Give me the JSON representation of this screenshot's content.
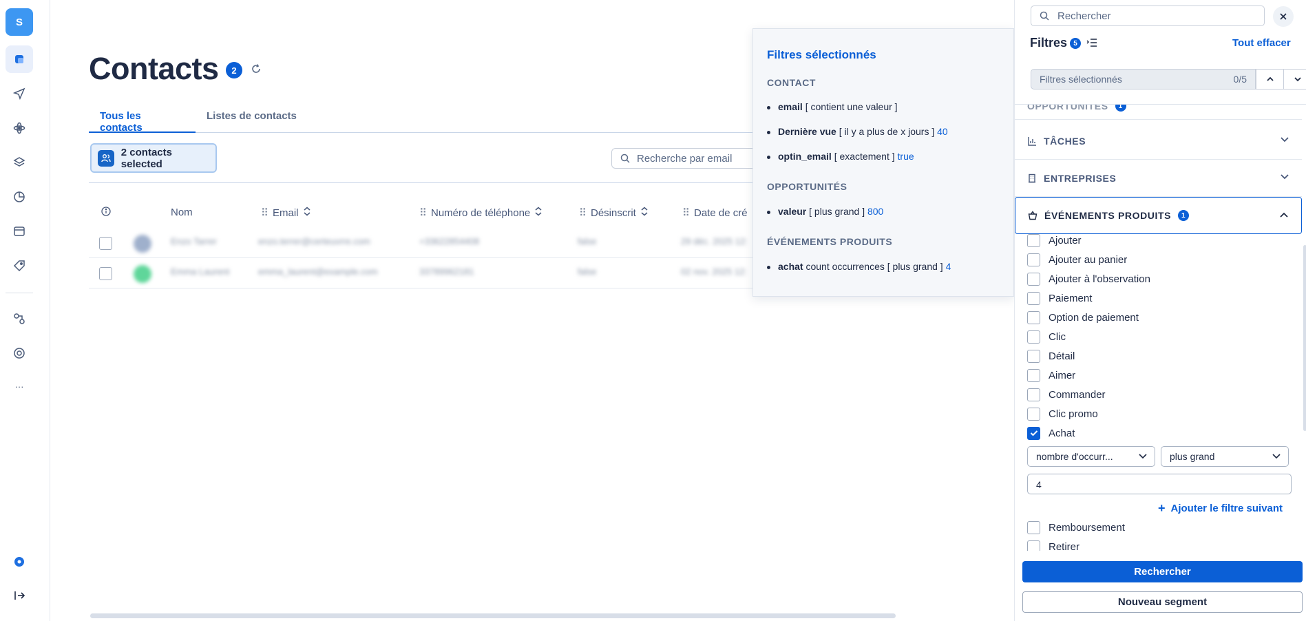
{
  "rail": {
    "avatar_letter": "S",
    "more_label": "···"
  },
  "page": {
    "title": "Contacts",
    "count": "2"
  },
  "tabs": [
    {
      "label": "Tous les contacts"
    },
    {
      "label": "Listes de contacts"
    }
  ],
  "selection": {
    "label": "2 contacts selected"
  },
  "search": {
    "placeholder": "Recherche par email"
  },
  "table": {
    "columns": [
      "Nom",
      "Email",
      "Numéro de téléphone",
      "Désinscrit",
      "Date de cré"
    ],
    "rows": [
      {
        "name": "Enzo Tarrer",
        "email": "enzo.terrer@certeuvrre.com",
        "phone": "+33622854408",
        "unsub": "false",
        "date": "29 déc. 2025 12:"
      },
      {
        "name": "Emma Laurent",
        "email": "emma_laurent@example.com",
        "phone": "33789962181",
        "unsub": "false",
        "date": "02 nov. 2025 12:"
      }
    ]
  },
  "popover": {
    "title": "Filtres sélectionnés",
    "sections": [
      {
        "title": "CONTACT",
        "items": [
          {
            "field": "email",
            "op": "[ contient une valeur ]",
            "value": ""
          },
          {
            "field": "Dernière vue",
            "op": "[ il y a plus de x jours ]",
            "value": "40"
          },
          {
            "field": "optin_email",
            "op": "[ exactement ]",
            "value": "true"
          }
        ]
      },
      {
        "title": "OPPORTUNITÉS",
        "items": [
          {
            "field": "valeur",
            "op": "[ plus grand ]",
            "value": "800"
          }
        ]
      },
      {
        "title": "ÉVÉNEMENTS PRODUITS",
        "items": [
          {
            "field": "achat",
            "op": "count occurrences [ plus grand ]",
            "value": "4"
          }
        ]
      }
    ]
  },
  "panel": {
    "search_placeholder": "Rechercher",
    "filters_title": "Filtres",
    "filters_count": "5",
    "clear_all": "Tout effacer",
    "selected_label": "Filtres sélectionnés",
    "selected_count": "0/5",
    "accordions": [
      {
        "label": "OPPORTUNITÉS",
        "badge": "1"
      },
      {
        "label": "TÂCHES"
      },
      {
        "label": "ENTREPRISES"
      },
      {
        "label": "ÉVÉNEMENTS PRODUITS",
        "badge": "1"
      }
    ],
    "options": [
      {
        "label": "Ajouter",
        "checked": false
      },
      {
        "label": "Ajouter au panier",
        "checked": false
      },
      {
        "label": "Ajouter à l'observation",
        "checked": false
      },
      {
        "label": "Paiement",
        "checked": false
      },
      {
        "label": "Option de paiement",
        "checked": false
      },
      {
        "label": "Clic",
        "checked": false
      },
      {
        "label": "Détail",
        "checked": false
      },
      {
        "label": "Aimer",
        "checked": false
      },
      {
        "label": "Commander",
        "checked": false
      },
      {
        "label": "Clic promo",
        "checked": false
      },
      {
        "label": "Achat",
        "checked": true
      },
      {
        "label": "Remboursement",
        "checked": false
      },
      {
        "label": "Retirer",
        "checked": false
      }
    ],
    "metric_select": "nombre d'occurr...",
    "operator_select": "plus grand",
    "value": "4",
    "add_next": "Ajouter le filtre suivant",
    "search_button": "Rechercher",
    "new_segment_button": "Nouveau segment"
  },
  "colors": {
    "accent": "#0b5fd6",
    "avatar": "#3d97f2"
  }
}
